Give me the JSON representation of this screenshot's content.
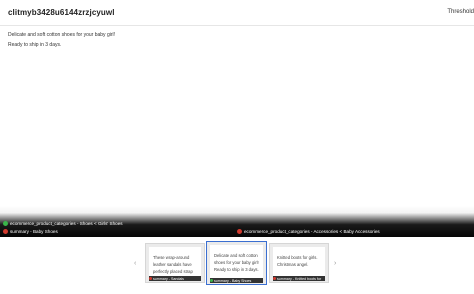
{
  "header": {
    "record_id": "clitmyb3428u6144zrzjcyuwl",
    "threshold_label": "Threshold"
  },
  "content": {
    "lines": [
      "Delicate and soft cotton shoes for your baby girl!",
      "Ready to ship in 3 days."
    ]
  },
  "labels": {
    "category_left": "ecommerce_product_categories - Shoes < Girls' Shoes",
    "summary_left": "summary - Baby Shoes",
    "category_right": "ecommerce_product_categories - Accessories < Baby Accessories"
  },
  "carousel": {
    "prev_glyph": "‹",
    "next_glyph": "›",
    "cards": [
      {
        "text": "These wrap-around leather sandals have perfectly placed strap",
        "footer": "summary - Sandals"
      },
      {
        "text": "Delicate and soft cotton shoes for your baby girl! Ready to ship in 3 days.",
        "footer": "summary - Baby Shoes"
      },
      {
        "text": "Knitted boots for girls. Christmas angel.",
        "footer": "summary - Knitted boots for"
      }
    ]
  },
  "colors": {
    "accent_selected": "#3b6fd1",
    "dot_green": "#3ab54a",
    "dot_red": "#d23a2e"
  }
}
